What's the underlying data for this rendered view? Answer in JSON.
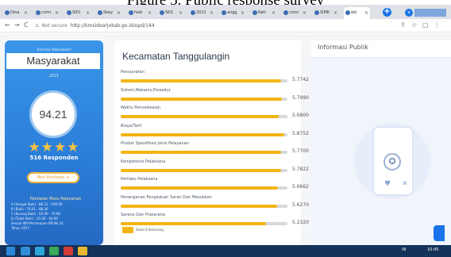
{
  "caption": "Figure 5. Public response survey",
  "browser": {
    "tabs": [
      {
        "label": "Dina"
      },
      {
        "label": "comi"
      },
      {
        "label": "SIDI"
      },
      {
        "label": "Skey"
      },
      {
        "label": "fadc"
      },
      {
        "label": "SKS"
      },
      {
        "label": "2021"
      },
      {
        "label": "angg"
      },
      {
        "label": "Rati"
      },
      {
        "label": "comi"
      },
      {
        "label": "SIMK"
      },
      {
        "label": "ekl"
      }
    ],
    "new_tab": "+",
    "profile": "v",
    "url_warning": "⚠",
    "url_not_secure": "Not secure",
    "url": "http://kmsidoarjokab.go.id/opd/144",
    "nav": {
      "back": "←",
      "forward": "→",
      "reload": "C"
    }
  },
  "left_card": {
    "label": "Survey Kepuasan",
    "title": "Masyarakat",
    "year": "2021",
    "score": "94.21",
    "stars": "★★★★",
    "respondents": "516 Responden",
    "rate_button": "Beri Penilaian ➜",
    "quality_title": "Penilaian Mutu Pelayanan",
    "quality_rows": [
      "A (Sangat Baik)       : 88.31 - 100.00",
      "B (Baik)              : 76.61 - 88.30",
      "C (Kurang Baik)       : 65.00 - 76.60",
      "D (Tidak Baik)        : 25.00 - 64.99",
      "Sesuai IKM Permenpan-RB No.14",
      "Tahun 2017"
    ]
  },
  "main_card": {
    "title": "Kecamatan Tanggulangin",
    "metrics": [
      {
        "label": "Persyaratan",
        "value": "5.7742",
        "score": 5.7742
      },
      {
        "label": "Sistem,Mekanis,Prosedur",
        "value": "5.7990",
        "score": 5.799
      },
      {
        "label": "Waktu Penyelesaian",
        "value": "5.6800",
        "score": 5.68
      },
      {
        "label": "Biaya/Tarif",
        "value": "5.8752",
        "score": 5.8752
      },
      {
        "label": "Produk Spesifikasi Jenis Pelayanan",
        "value": "5.7700",
        "score": 5.77
      },
      {
        "label": "Kompetensi Pelaksana",
        "value": "5.7822",
        "score": 5.7822
      },
      {
        "label": "Perilaku Pelaksana",
        "value": "5.6662",
        "score": 5.6662
      },
      {
        "label": "Penanganan Pengaduan Saran Dan Masukkan",
        "value": "5.6270",
        "score": 5.627
      },
      {
        "label": "Sarana Dan Prasarana",
        "value": "5.2320",
        "score": 5.232
      }
    ],
    "score_max": 6,
    "legend": "Skala 6 Sekarang"
  },
  "right_panel": {
    "title": "Informasi Publik"
  },
  "taskbar": {
    "tray_text": "IN",
    "time": "10:45"
  },
  "colors": {
    "accent_blue": "#2b7fd9",
    "bar_fill": "#f2b516",
    "bar_track": "#d6d9dd",
    "star": "#f6c343"
  }
}
